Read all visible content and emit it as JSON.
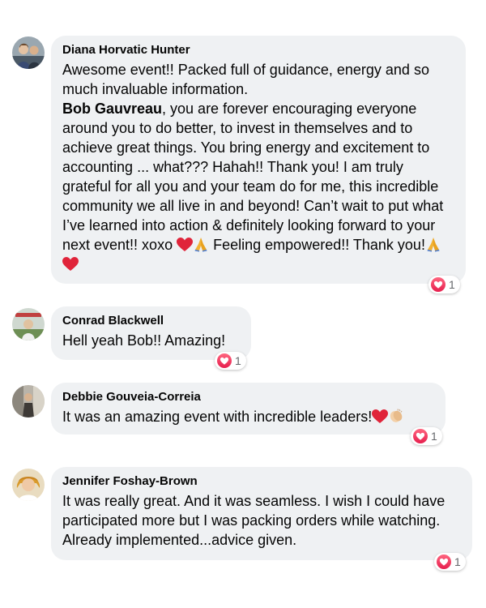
{
  "comments": [
    {
      "author": "Diana Horvatic Hunter",
      "text_a": "Awesome event!! Packed full of guidance, energy and so much invaluable information.",
      "mention": "Bob Gauvreau",
      "text_b": ", you are forever encouraging everyone around you to do better, to invest in themselves and to achieve great things. You bring energy and excitement to accounting ... what??? Hahah!! Thank you! I am truly grateful for all you and your team do for me, this incredible community we all live in and beyond! Can’t wait to put what I’ve learned into action & definitely looking forward to your next event!! xoxo",
      "text_c": "Feeling empowered!! Thank you!",
      "reaction_count": "1"
    },
    {
      "author": "Conrad Blackwell",
      "text": "Hell yeah Bob!! Amazing!",
      "reaction_count": "1"
    },
    {
      "author": "Debbie Gouveia-Correia",
      "text": "It was an amazing event with incredible leaders!",
      "reaction_count": "1"
    },
    {
      "author": "Jennifer Foshay-Brown",
      "text": "It was really great. And it was seamless. I wish I could have participated more but I was packing orders while watching. Already implemented...advice given.",
      "reaction_count": "1"
    }
  ],
  "colors": {
    "bubble": "#eff1f3",
    "heart": "#e61e4d"
  }
}
